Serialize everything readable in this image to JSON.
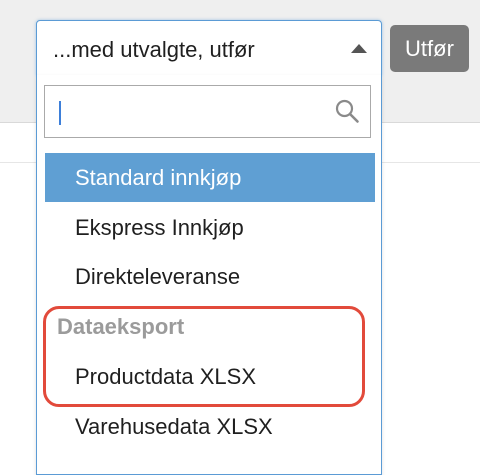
{
  "bulk_action": {
    "selected_label": "...med utvalgte, utfør",
    "execute_label": "Utfør"
  },
  "search": {
    "value": "",
    "placeholder": ""
  },
  "options": {
    "standard_purchase": "Standard innkjøp",
    "express_purchase": "Ekspress Innkjøp",
    "direct_delivery": "Direkteleveranse"
  },
  "groups": {
    "data_export": {
      "label": "Dataeksport",
      "items": [
        "Productdata XLSX",
        "Varehusedata XLSX"
      ]
    }
  },
  "icons": {
    "search": "search-icon",
    "dropdown_arrow": "chevron-up-icon"
  },
  "colors": {
    "selected_option_bg": "#5f9fd3",
    "focus_border": "#5b9bd5",
    "execute_button_bg": "#7a7a7a",
    "annotation_highlight": "#e24a3b",
    "group_label": "#9b9b9b"
  }
}
